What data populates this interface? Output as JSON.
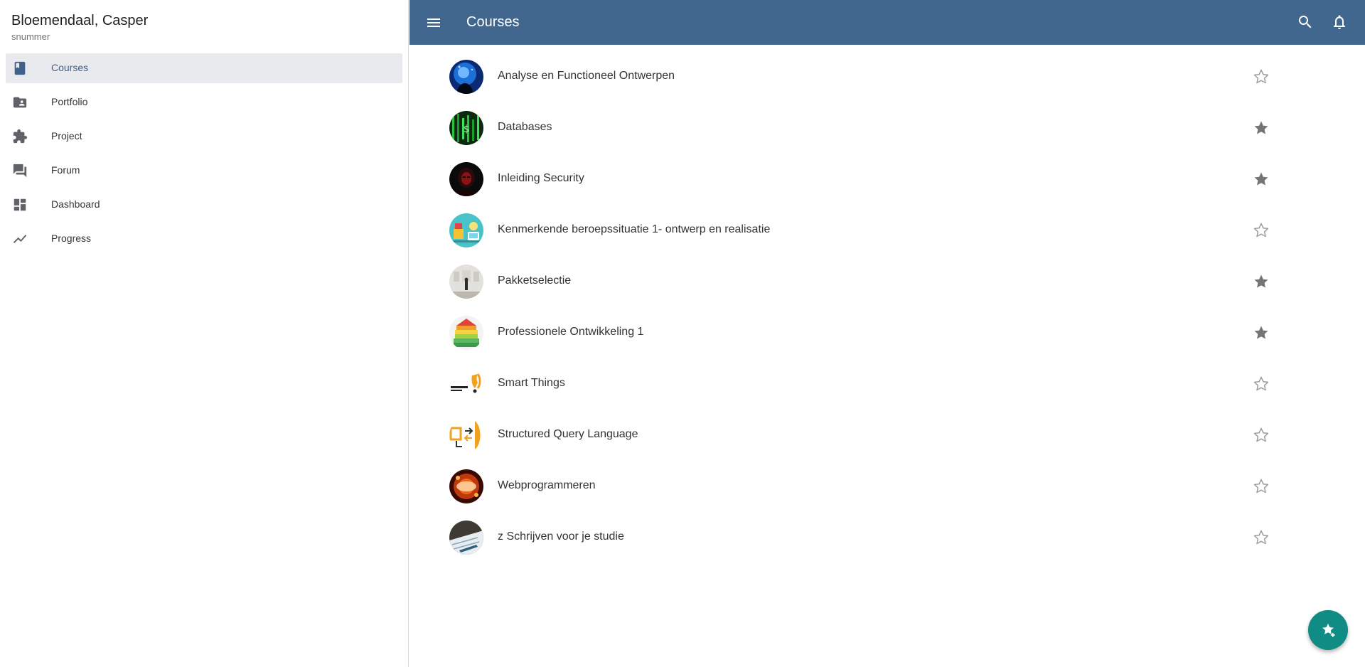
{
  "user": {
    "name": "Bloemendaal, Casper",
    "subtitle": "snummer"
  },
  "nav": [
    {
      "label": "Courses",
      "icon": "book-icon",
      "active": true
    },
    {
      "label": "Portfolio",
      "icon": "folder-account-icon",
      "active": false
    },
    {
      "label": "Project",
      "icon": "puzzle-icon",
      "active": false
    },
    {
      "label": "Forum",
      "icon": "forum-icon",
      "active": false
    },
    {
      "label": "Dashboard",
      "icon": "dashboard-icon",
      "active": false
    },
    {
      "label": "Progress",
      "icon": "trending-up-icon",
      "active": false
    }
  ],
  "topbar": {
    "title": "Courses",
    "menu_icon": "menu-icon",
    "search_icon": "search-icon",
    "bell_icon": "bell-icon",
    "color": "#41678f"
  },
  "courses": [
    {
      "name": "Analyse en Functioneel Ontwerpen",
      "starred": false
    },
    {
      "name": "Databases",
      "starred": true
    },
    {
      "name": "Inleiding Security",
      "starred": true
    },
    {
      "name": "Kenmerkende beroepssituatie 1- ontwerp en realisatie",
      "starred": false
    },
    {
      "name": "Pakketselectie",
      "starred": true
    },
    {
      "name": "Professionele Ontwikkeling 1",
      "starred": true
    },
    {
      "name": "Smart Things",
      "starred": false
    },
    {
      "name": "Structured Query Language",
      "starred": false
    },
    {
      "name": "Webprogrammeren",
      "starred": false
    },
    {
      "name": "z Schrijven voor je studie",
      "starred": false
    }
  ],
  "fab": {
    "icon": "star-add-icon",
    "color": "#108c84"
  },
  "accent": "#3f618a"
}
